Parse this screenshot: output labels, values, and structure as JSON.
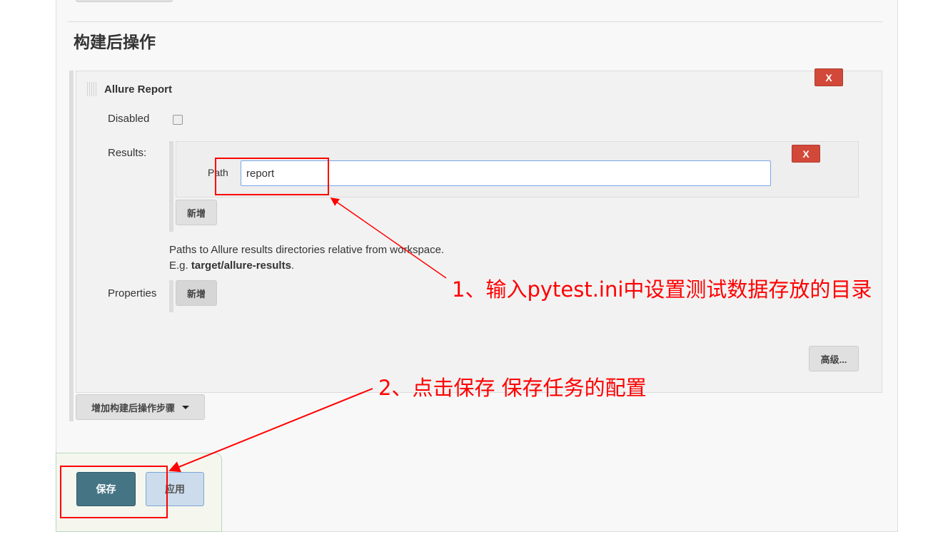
{
  "section": {
    "title": "构建后操作"
  },
  "allure": {
    "title": "Allure Report",
    "delete_label": "X",
    "disabled_label": "Disabled",
    "results_label": "Results:",
    "path_label": "Path",
    "path_value": "report",
    "path_delete_label": "X",
    "add_result_label": "新增",
    "help_line1": "Paths to Allure results directories relative from workspace.",
    "help_eg": "E.g. ",
    "help_example": "target/allure-results",
    "help_period": ".",
    "properties_label": "Properties",
    "add_property_label": "新增",
    "advanced_label": "高级..."
  },
  "add_step": {
    "label": "增加构建后操作步骤"
  },
  "footer": {
    "save_label": "保存",
    "apply_label": "应用"
  },
  "annotations": {
    "note1": "1、输入pytest.ini中设置测试数据存放的目录",
    "note2": "2、点击保存 保存任务的配置",
    "color": "#ff0000"
  }
}
